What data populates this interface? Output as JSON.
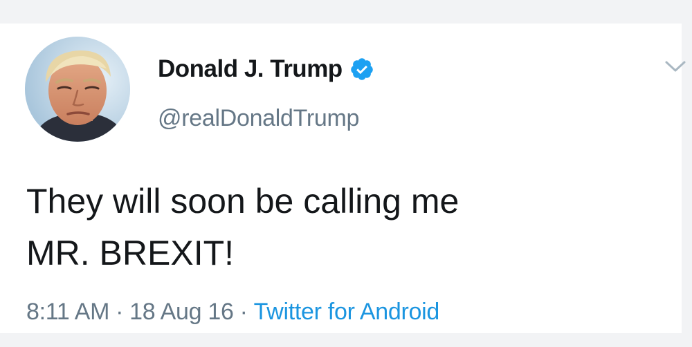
{
  "tweet": {
    "author": {
      "display_name": "Donald J. Trump",
      "handle": "@realDonaldTrump",
      "verified": true,
      "avatar_icon": "profile-photo"
    },
    "text_lines": [
      "They will soon be calling me",
      "MR. BREXIT!"
    ],
    "meta": {
      "time": "8:11 AM",
      "date": "18 Aug 16",
      "separator": "·",
      "source": "Twitter for Android"
    },
    "menu_icon": "chevron-down-icon"
  },
  "colors": {
    "text_primary": "#14171a",
    "text_secondary": "#657786",
    "link_blue": "#1b95e0",
    "verified_blue": "#1da1f2",
    "background": "#ffffff"
  }
}
